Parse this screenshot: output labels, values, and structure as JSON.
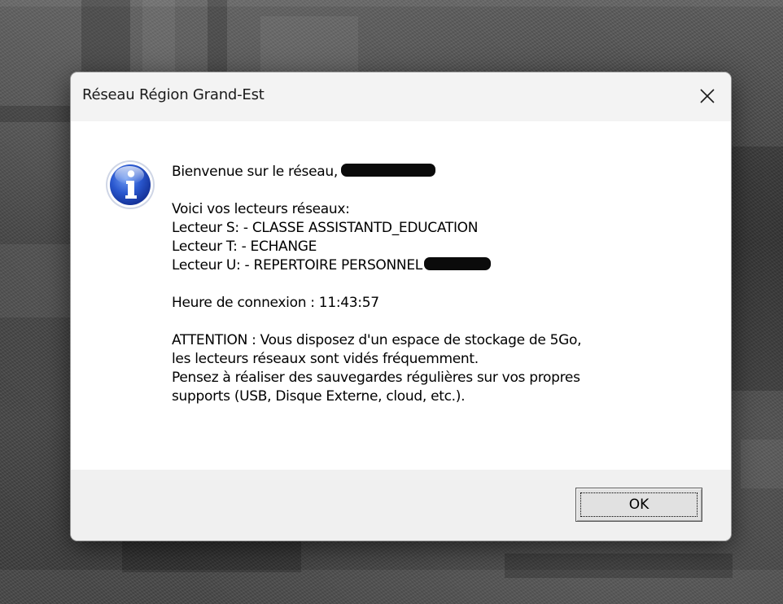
{
  "window": {
    "title": "Réseau Région Grand-Est",
    "close_icon": "close-icon"
  },
  "message": {
    "icon": "info-icon",
    "welcome": "Bienvenue sur le réseau,",
    "drives_heading": "Voici vos lecteurs réseaux:",
    "drive_s": "Lecteur S: - CLASSE ASSISTANTD_EDUCATION",
    "drive_t": "Lecteur T: - ECHANGE",
    "drive_u": "Lecteur U: - REPERTOIRE PERSONNEL",
    "connection_time": "Heure de connexion : 11:43:57",
    "warning_line1": "ATTENTION : Vous disposez d'un espace de stockage de 5Go,",
    "warning_line2": "les lecteurs réseaux sont vidés fréquemment.",
    "warning_line3": "Pensez à réaliser des sauvegardes régulières sur vos propres",
    "warning_line4": "supports (USB, Disque Externe, cloud, etc.)."
  },
  "footer": {
    "ok_label": "OK"
  },
  "colors": {
    "info_blue": "#1f4fc4",
    "dialog_bg": "#ffffff",
    "footer_bg": "#f0f0f0",
    "titlebar_bg": "#f3f3f3"
  }
}
